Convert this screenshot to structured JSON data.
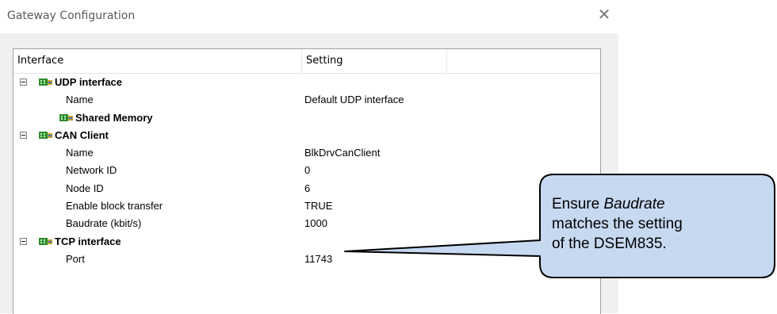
{
  "window": {
    "title": "Gateway Configuration",
    "close_glyph": "✕"
  },
  "tree": {
    "columns": [
      "Interface",
      "Setting"
    ],
    "rows": [
      {
        "label": "UDP interface",
        "value": "",
        "kind": "group",
        "icon": "network-card-icon",
        "expandable": true
      },
      {
        "label": "Name",
        "value": "Default UDP interface",
        "kind": "property"
      },
      {
        "label": "Shared Memory",
        "value": "",
        "kind": "subgroup",
        "icon": "network-card-icon"
      },
      {
        "label": "CAN Client",
        "value": "",
        "kind": "group",
        "icon": "network-card-icon",
        "expandable": true
      },
      {
        "label": "Name",
        "value": "BlkDrvCanClient",
        "kind": "property"
      },
      {
        "label": "Network ID",
        "value": "0",
        "kind": "property"
      },
      {
        "label": "Node ID",
        "value": "6",
        "kind": "property"
      },
      {
        "label": "Enable block transfer",
        "value": "TRUE",
        "kind": "property"
      },
      {
        "label": "Baudrate (kbit/s)",
        "value": "1000",
        "kind": "property"
      },
      {
        "label": "TCP interface",
        "value": "",
        "kind": "group",
        "icon": "network-card-icon",
        "expandable": true
      },
      {
        "label": "Port",
        "value": "11743",
        "kind": "property"
      }
    ]
  },
  "callout": {
    "line1_prefix": "Ensure ",
    "line1_emph": "Baudrate",
    "line2": "matches the setting",
    "line3": "of the DSEM835.",
    "fill": "#c6d9f1",
    "stroke": "#000000"
  }
}
